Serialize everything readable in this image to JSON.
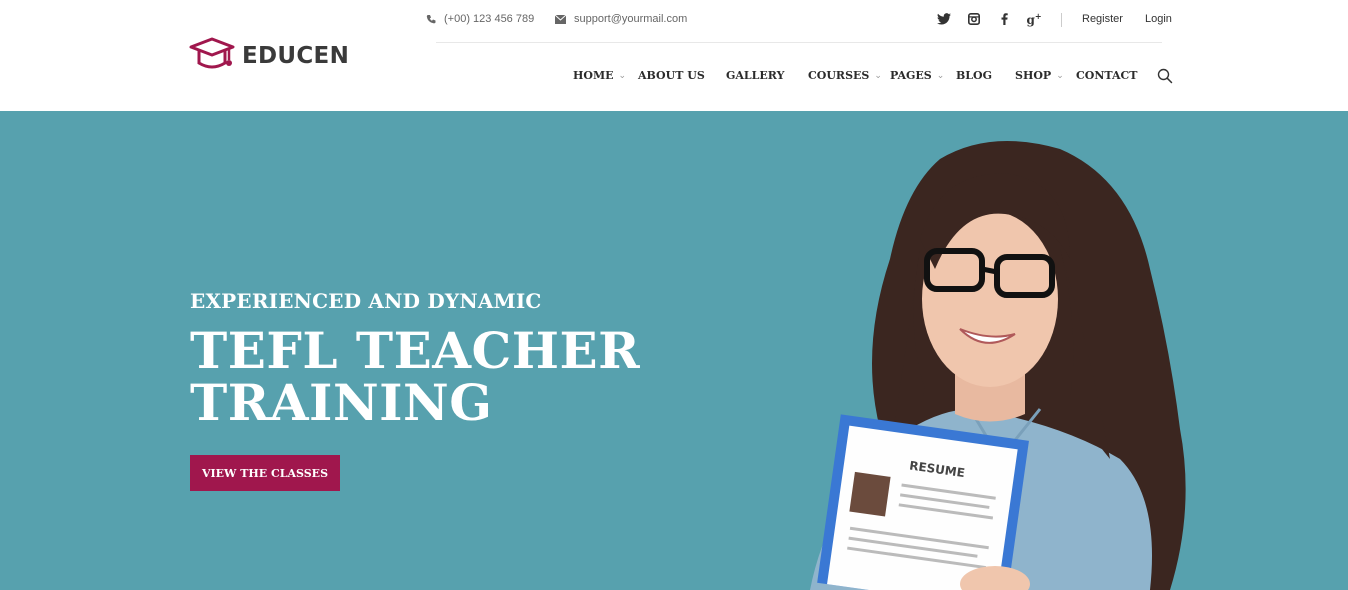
{
  "brand": {
    "name": "EDUCEN",
    "logo_icon": "graduation-cap-icon",
    "accent": "#a0174d"
  },
  "topbar": {
    "phone": "(+00) 123 456 789",
    "email": "support@yourmail.com",
    "socials": [
      "twitter-icon",
      "instagram-icon",
      "facebook-icon",
      "google-plus-icon"
    ],
    "register": "Register",
    "login": "Login"
  },
  "nav": {
    "items": [
      {
        "label": "HOME",
        "dropdown": true
      },
      {
        "label": "ABOUT US",
        "dropdown": false
      },
      {
        "label": "GALLERY",
        "dropdown": false
      },
      {
        "label": "COURSES",
        "dropdown": true
      },
      {
        "label": "PAGES",
        "dropdown": true
      },
      {
        "label": "BLOG",
        "dropdown": false
      },
      {
        "label": "SHOP",
        "dropdown": true
      },
      {
        "label": "CONTACT",
        "dropdown": false
      }
    ],
    "caret": "⌄"
  },
  "hero": {
    "background": "#57a1ae",
    "eyebrow": "EXPERIENCED AND DYNAMIC",
    "title_line1": "TEFL TEACHER",
    "title_line2": "TRAINING",
    "cta": "VIEW THE CLASSES",
    "folder_text": "RESUME"
  }
}
